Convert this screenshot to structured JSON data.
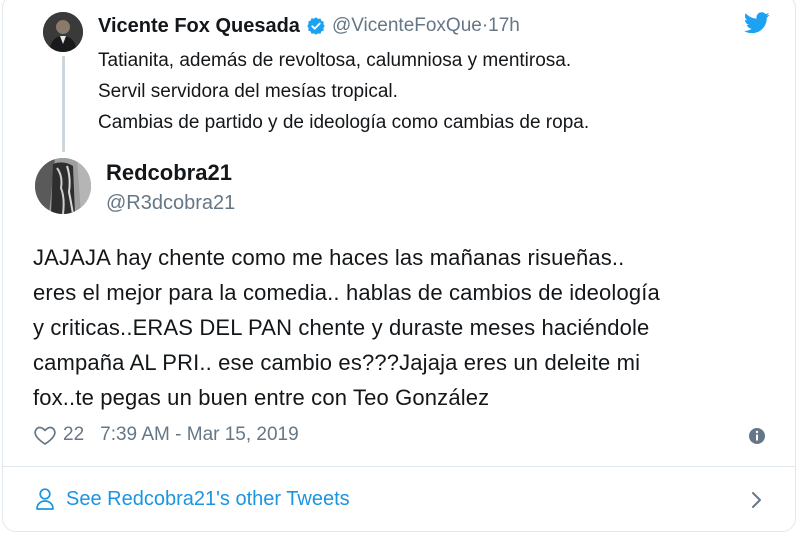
{
  "parent_tweet": {
    "name": "Vicente Fox Quesada",
    "handle": "@VicenteFoxQue",
    "separator": " · ",
    "time": "17h",
    "lines": [
      "Tatianita, además de revoltosa, calumniosa y mentirosa.",
      "Servil servidora del mesías tropical.",
      "Cambias de partido y de ideología como cambias de ropa."
    ],
    "verified_icon": "verified-badge-icon",
    "brand_icon": "twitter-bird-icon"
  },
  "tweet": {
    "name": "Redcobra21",
    "handle": "@R3dcobra21",
    "lines": [
      "JAJAJA hay chente como me haces las mañanas risueñas..",
      "eres el mejor para la comedia.. hablas de cambios de ideología",
      "y criticas..ERAS DEL PAN chente y duraste meses haciéndole",
      "campaña AL PRI.. ese cambio es???Jajaja eres un deleite mi",
      "fox..te pegas un buen entre con Teo González"
    ],
    "likes": "22",
    "timestamp": "7:39 AM - Mar 15, 2019"
  },
  "footer": {
    "link_label": "See Redcobra21's other Tweets",
    "icon": "person-icon"
  },
  "colors": {
    "text": "#14171a",
    "secondary": "#657786",
    "link": "#1b95e0",
    "verified": "#1da1f2",
    "border": "#e1e8ed"
  }
}
